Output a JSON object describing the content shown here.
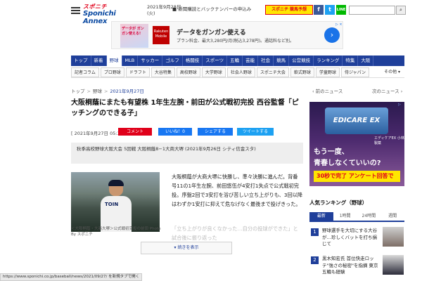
{
  "header": {
    "logo_line1": "スポニチ",
    "logo_line2": "Sponichi Annex",
    "date": "2021年9月28日",
    "weekday": "(火)",
    "news_line": "■ 新聞購読とバックナンバーの申込み",
    "promo": "スポニチ 競馬予想",
    "social_fb": "f",
    "social_tw": "t",
    "social_line": "LINE",
    "search_placeholder": "",
    "search_icon": "search-icon"
  },
  "ad_banner": {
    "pic_text": "データが ガンガン使える!",
    "rakuten": "Rakuten Mobile",
    "title": "データをガンガン使える",
    "subtitle": "プラン料金、最大3,280円/月(税込3,278円)。通話料など別。",
    "arrow": "›",
    "close": "▷ ×"
  },
  "nav_main": [
    {
      "label": "トップ",
      "active": false
    },
    {
      "label": "新着",
      "active": false
    },
    {
      "label": "野球",
      "active": true
    },
    {
      "label": "MLB",
      "active": false
    },
    {
      "label": "サッカー",
      "active": false
    },
    {
      "label": "ゴルフ",
      "active": false
    },
    {
      "label": "格闘技",
      "active": false
    },
    {
      "label": "スポーツ",
      "active": false
    },
    {
      "label": "五輪",
      "active": false
    },
    {
      "label": "芸能",
      "active": false
    },
    {
      "label": "社会",
      "active": false
    },
    {
      "label": "競馬",
      "active": false
    },
    {
      "label": "公営競技",
      "active": false
    },
    {
      "label": "ランキング",
      "active": false
    },
    {
      "label": "特集",
      "active": false
    },
    {
      "label": "大阪",
      "active": false
    }
  ],
  "nav_sub": [
    "記者コラム",
    "プロ野球",
    "ドラフト",
    "大谷特集",
    "高校野球",
    "大学野球",
    "社会人野球",
    "スポニチ大会",
    "軟式野球",
    "学童野球",
    "侍ジャパン"
  ],
  "nav_sub_more": "その他 ▾",
  "breadcrumb": [
    "トップ",
    "野球",
    "2021年9月27日"
  ],
  "article": {
    "headline": "大阪桐蔭にまたも有望株 1年生左腕・前田が公式戦初完投 西谷監督「ピッチングのできる子」",
    "time": "[ 2021年9月27日 05:30 ]",
    "comment_label": "コメント",
    "like_label": "いいね！0",
    "share_label": "シェアする",
    "tweet_label": "ツイートする",
    "info": "秋季高校野球大阪大会 5回戦 大阪桐蔭8−1大商大堺 (2021年9月26日 シティ信金スタ)",
    "photo_letters": "TOIN",
    "caption": "＜大阪桐蔭・大商大堺＞公式戦初完投の前田 Photo By スポニチ",
    "body": "大阪桐蔭が大商大堺に快勝し、準々決勝に進んだ。背番号11の1年生左腕、前田悠伍が4安打1失点で公式戦初完投。序盤2回で3安打を浴び苦しい立ち上がりも、3回以降はわずか1安打に抑えて危なげなく最後まで投げきった。",
    "fade": "「立ち上がりが良くなかった…自分の投球ができた」と試合後に振り返った",
    "more_button": "▾ 続きを表示"
  },
  "status_url": "https://www.sponichi.co.jp/baseball/news/2021/09/27/ を新規タブで開く",
  "side": {
    "prev": "‹ 前のニュース",
    "next": "次のニュース ›",
    "ad_product": "EDICARE EX",
    "ad_brand": "エディケアEX 小林製薬",
    "ad_copy1": "もう一度、",
    "ad_copy2": "青春しなくていいの?",
    "ad_cta": "30秒で完了 アンケート回答で",
    "ad_tag": "▷",
    "ranking_title": "人気ランキング（野球）",
    "rank_tabs": [
      "最新",
      "1時間",
      "24時間",
      "週間"
    ],
    "rank_items": [
      {
        "num": "1",
        "text": "野球選手を大切にする大谷が…珍しくバットを打ち損じて"
      },
      {
        "num": "2",
        "text": "黒木知宏氏 首位快走ロッテ\"強さの秘密\"を指摘 東京五輪も経験"
      }
    ]
  }
}
